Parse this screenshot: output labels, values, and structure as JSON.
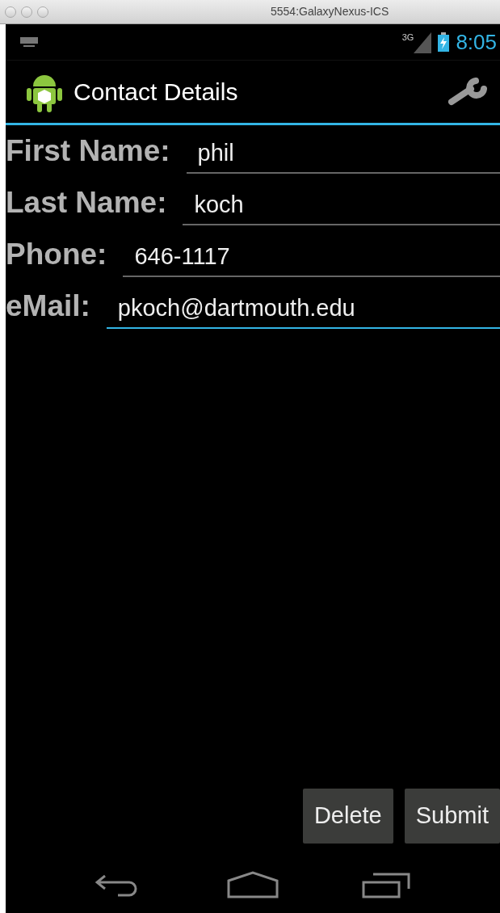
{
  "window": {
    "title": "5554:GalaxyNexus-ICS"
  },
  "status_bar": {
    "network": "3G",
    "time": "8:05"
  },
  "action_bar": {
    "title": "Contact Details"
  },
  "fields": [
    {
      "label": "First Name:",
      "value": "phil",
      "focused": false
    },
    {
      "label": "Last Name:",
      "value": "koch",
      "focused": false
    },
    {
      "label": "Phone:",
      "value": "646-1117",
      "focused": false
    },
    {
      "label": "eMail:",
      "value": "pkoch@dartmouth.edu",
      "focused": true
    }
  ],
  "buttons": [
    "Delete",
    "Submit"
  ]
}
